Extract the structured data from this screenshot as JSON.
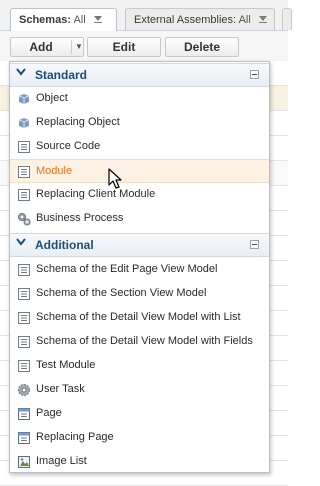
{
  "tabs": [
    {
      "label": "Schemas:",
      "value": "All",
      "icon": "filter-icon"
    },
    {
      "label": "External Assemblies:",
      "value": "All",
      "icon": "filter-icon"
    }
  ],
  "toolbar": {
    "add_label": "Add",
    "edit_label": "Edit",
    "delete_label": "Delete"
  },
  "menu": {
    "groups": [
      {
        "label": "Standard",
        "items": [
          {
            "label": "Object",
            "icon": "object-cube-icon"
          },
          {
            "label": "Replacing Object",
            "icon": "object-cube-icon"
          },
          {
            "label": "Source Code",
            "icon": "document-icon"
          },
          {
            "label": "Module",
            "icon": "document-icon",
            "state": "hover"
          },
          {
            "label": "Replacing Client Module",
            "icon": "document-icon"
          },
          {
            "label": "Business Process",
            "icon": "gears-icon"
          }
        ]
      },
      {
        "label": "Additional",
        "items": [
          {
            "label": "Schema of the Edit Page View Model",
            "icon": "document-icon"
          },
          {
            "label": "Schema of the Section View Model",
            "icon": "document-icon"
          },
          {
            "label": "Schema of the Detail View Model with List",
            "icon": "document-icon"
          },
          {
            "label": "Schema of the Detail View Model with Fields",
            "icon": "document-icon"
          },
          {
            "label": "Test Module",
            "icon": "document-icon"
          },
          {
            "label": "User Task",
            "icon": "gear-icon"
          },
          {
            "label": "Page",
            "icon": "page-icon"
          },
          {
            "label": "Replacing Page",
            "icon": "page-icon"
          },
          {
            "label": "Image List",
            "icon": "image-list-icon"
          }
        ]
      }
    ]
  },
  "colors": {
    "hover_text": "#e8731d",
    "group_text": "#1b4f7a"
  }
}
